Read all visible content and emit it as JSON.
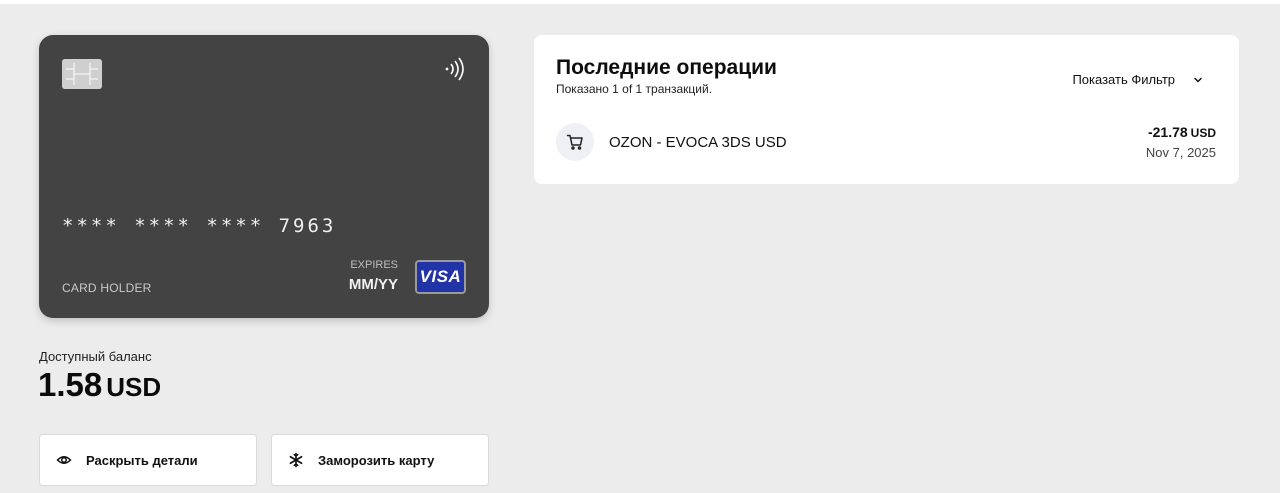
{
  "card": {
    "number": "**** **** **** 7963",
    "holder_label": "CARD HOLDER",
    "expires_label": "EXPIRES",
    "expires_value": "MM/YY",
    "network": "VISA"
  },
  "balance": {
    "label": "Доступный баланс",
    "amount": "1.58",
    "currency": "USD"
  },
  "actions": {
    "reveal_label": "Раскрыть детали",
    "freeze_label": "Заморозить карту"
  },
  "transactions": {
    "title": "Последние операции",
    "subtitle": "Показано 1 of 1 транзакций.",
    "filter_label": "Показать Фильтр",
    "items": [
      {
        "merchant": "OZON - EVOCA 3DS USD",
        "amount": "-21.78",
        "currency": "USD",
        "date": "Nov 7, 2025",
        "icon": "cart-icon"
      }
    ]
  },
  "colors": {
    "background": "#ececec",
    "card": "#434343",
    "visa": "#2233a8",
    "panel": "#ffffff"
  }
}
